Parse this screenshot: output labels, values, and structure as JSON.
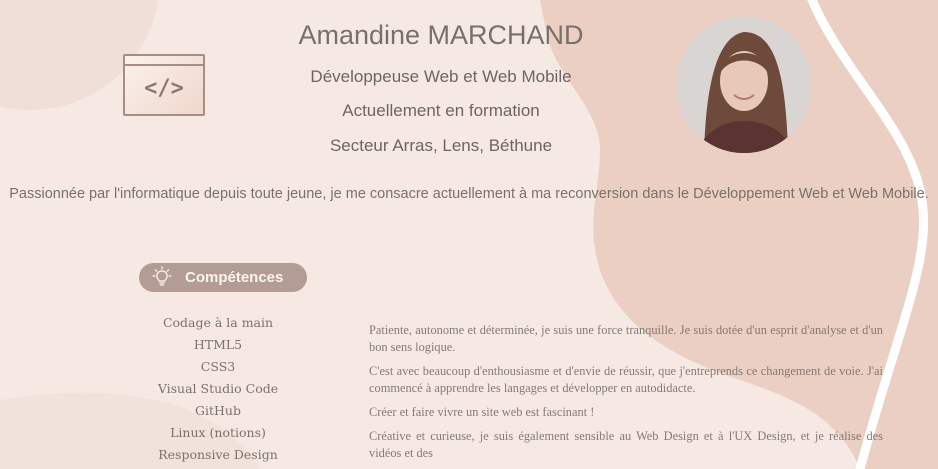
{
  "header": {
    "name": "Amandine MARCHAND",
    "lines": [
      "Développeuse Web et Web Mobile",
      "Actuellement en formation",
      "Secteur Arras, Lens, Béthune"
    ],
    "code_icon": "code-window-icon",
    "code_glyph": "</>"
  },
  "tagline": "Passionnée par l'informatique depuis toute jeune, je me consacre actuellement à ma reconversion dans le Développement Web et Web Mobile.",
  "skills": {
    "title": "Compétences",
    "icon": "lightbulb-icon",
    "items": [
      "Codage à la main",
      "HTML5",
      "CSS3",
      "Visual Studio Code",
      "GitHub",
      "Linux (notions)",
      "Responsive Design"
    ]
  },
  "about": [
    "Patiente, autonome et déterminée, je suis une force tranquille. Je suis dotée d'un esprit d'analyse et d'un bon sens logique.",
    "C'est avec beaucoup d'enthousiasme et d'envie de réussir, que j'entreprends ce changement de voie. J'ai commencé à apprendre les langages et développer en autodidacte.",
    "Créer et faire vivre un site web est fascinant !",
    "Créative et curieuse, je suis également sensible au Web Design et à l'UX Design, et je réalise des vidéos et des"
  ],
  "colors": {
    "background": "#f6e9e3",
    "blob": "#ebcfc2",
    "accent": "#b39c93",
    "text": "#6f6460"
  }
}
